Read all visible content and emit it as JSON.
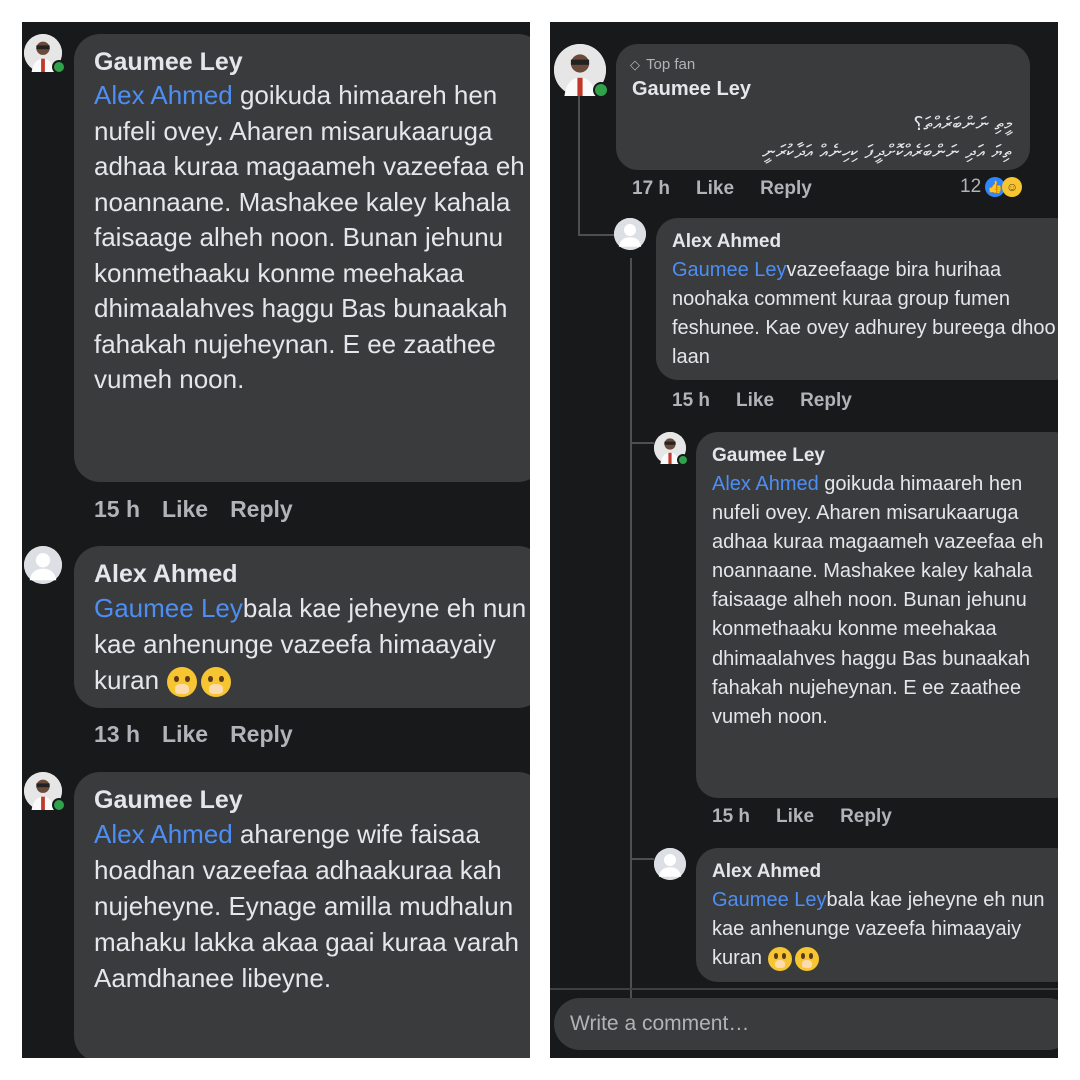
{
  "left": {
    "comments": [
      {
        "author": "Gaumee Ley",
        "mention": "Alex Ahmed",
        "text": " goikuda himaareh hen nufeli ovey. Aharen misarukaaruga adhaa kuraa magaameh vazeefaa eh noannaane. Mashakee kaley kahala faisaage alheh noon. Bunan jehunu konmethaaku konme meehakaa dhimaalahves haggu Bas bunaakah fahakah nujeheynan. E ee zaathee vumeh noon.",
        "time": "15 h",
        "like": "Like",
        "reply": "Reply"
      },
      {
        "author": "Alex Ahmed",
        "mention": "Gaumee Ley",
        "text": "bala kae jeheyne eh nun kae anhenunge vazeefa himaayaiy kuran",
        "emojis": [
          "face-with-hand-over-mouth",
          "face-with-hand-over-mouth"
        ],
        "time": "13 h",
        "like": "Like",
        "reply": "Reply"
      },
      {
        "author": "Gaumee Ley",
        "mention": "Alex Ahmed",
        "text": " aharenge wife faisaa hoadhan vazeefaa adhaakuraa kah nujeheyne. Eynage amilla mudhalun mahaku lakka akaa gaai kuraa varah Aamdhanee libeyne."
      }
    ]
  },
  "right": {
    "top_comment": {
      "badge_icon": "diamond-icon",
      "badge": "Top fan",
      "author": "Gaumee Ley",
      "text_line1": "މީތި ނަންބަރެއްތަ؟",
      "text_line2": "ތިޔަ އަދި ނަންބަރެއްކޮށްދީފަ ކިހިނެއް އަދާކުރަނީ",
      "time": "17 h",
      "like": "Like",
      "reply": "Reply",
      "reaction_count": "12"
    },
    "replies": [
      {
        "author": "Alex Ahmed",
        "mention": "Gaumee Ley",
        "text": "vazeefaage bira hurihaa noohaka comment kuraa group fumen feshunee. Kae ovey adhurey bureega dhoo laan",
        "time": "15 h",
        "like": "Like",
        "reply": "Reply"
      },
      {
        "author": "Gaumee Ley",
        "mention": "Alex Ahmed",
        "text": " goikuda himaareh hen nufeli ovey. Aharen misarukaaruga adhaa kuraa magaameh vazeefaa eh noannaane. Mashakee kaley kahala faisaage alheh noon. Bunan jehunu konmethaaku konme meehakaa dhimaalahves haggu Bas bunaakah fahakah nujeheynan. E ee zaathee vumeh noon.",
        "time": "15 h",
        "like": "Like",
        "reply": "Reply"
      },
      {
        "author": "Alex Ahmed",
        "mention": "Gaumee Ley",
        "text": "bala kae jeheyne eh nun kae anhenunge vazeefa himaayaiy kuran",
        "emojis": [
          "face-with-hand-over-mouth",
          "face-with-hand-over-mouth"
        ]
      }
    ],
    "composer_placeholder": "Write a comment…"
  },
  "colors": {
    "background": "#18191a",
    "bubble": "#3a3b3c",
    "text": "#e4e6eb",
    "meta": "#b0b3b8",
    "mention": "#4d8ef5",
    "online": "#31a24c"
  }
}
